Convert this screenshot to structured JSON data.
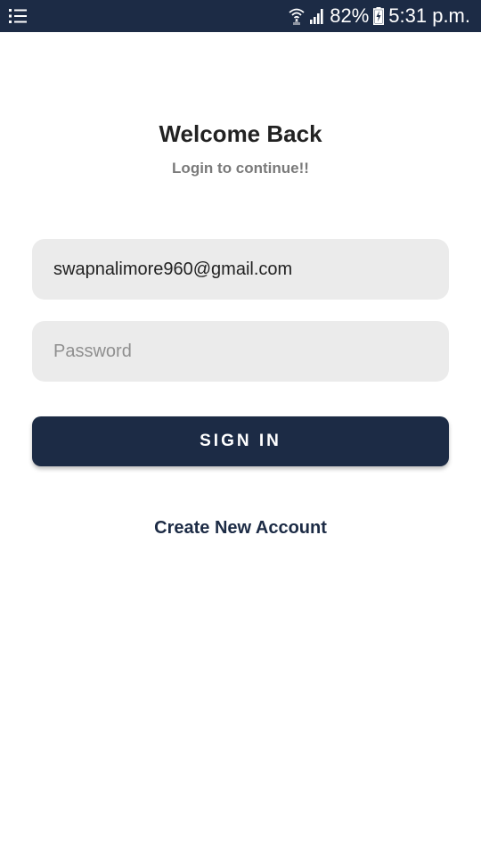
{
  "status_bar": {
    "menu_icon": "list-icon",
    "wifi_icon": "wifi-icon",
    "signal_icon": "signal-icon",
    "battery_percent": "82%",
    "battery_icon": "battery-charging-icon",
    "time": "5:31 p.m."
  },
  "login": {
    "title": "Welcome Back",
    "subtitle": "Login to continue!!",
    "email_value": "swapnalimore960@gmail.com",
    "password_placeholder": "Password",
    "signin_label": "SIGN IN",
    "create_account_label": "Create New Account"
  },
  "colors": {
    "primary": "#1c2b45",
    "input_background": "#ebebeb",
    "title_text": "#222222",
    "subtitle_text": "#7a7a7a"
  }
}
